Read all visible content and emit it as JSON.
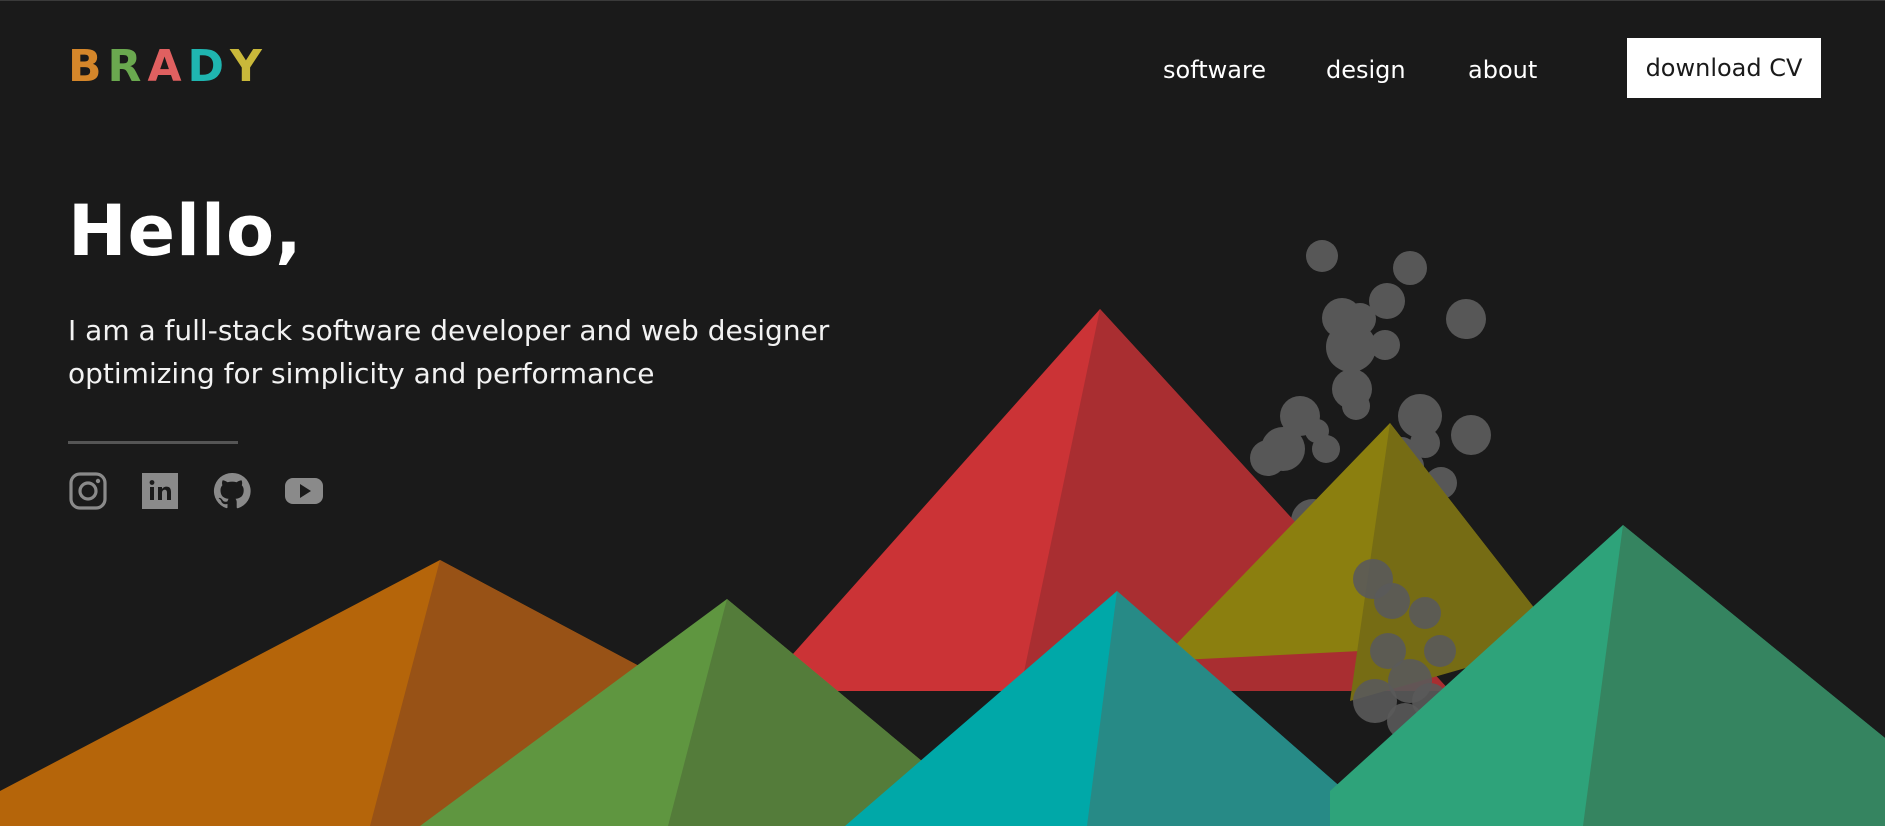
{
  "header": {
    "logo_letters": [
      {
        "char": "B",
        "color": "#d4862a"
      },
      {
        "char": "R",
        "color": "#6aa84f"
      },
      {
        "char": "A",
        "color": "#e06060"
      },
      {
        "char": "D",
        "color": "#1fb5b0"
      },
      {
        "char": "Y",
        "color": "#c9b83a"
      }
    ],
    "nav": {
      "software": "software",
      "design": "design",
      "about": "about"
    },
    "cv_button": "download CV"
  },
  "hero": {
    "greeting": "Hello,",
    "tagline_line1": "I am a full-stack software developer and web designer",
    "tagline_line2": "optimizing for simplicity and performance"
  },
  "social": [
    {
      "name": "instagram-icon"
    },
    {
      "name": "linkedin-icon"
    },
    {
      "name": "github-icon"
    },
    {
      "name": "youtube-icon"
    }
  ],
  "colors": {
    "background": "#1a1a1a",
    "orange": "#b5650a",
    "green": "#5f9640",
    "red": "#cb3336",
    "olive": "#8b7f0f",
    "teal": "#00a8a8",
    "emerald": "#2ea37a",
    "smoke": "#8a8a8a"
  }
}
